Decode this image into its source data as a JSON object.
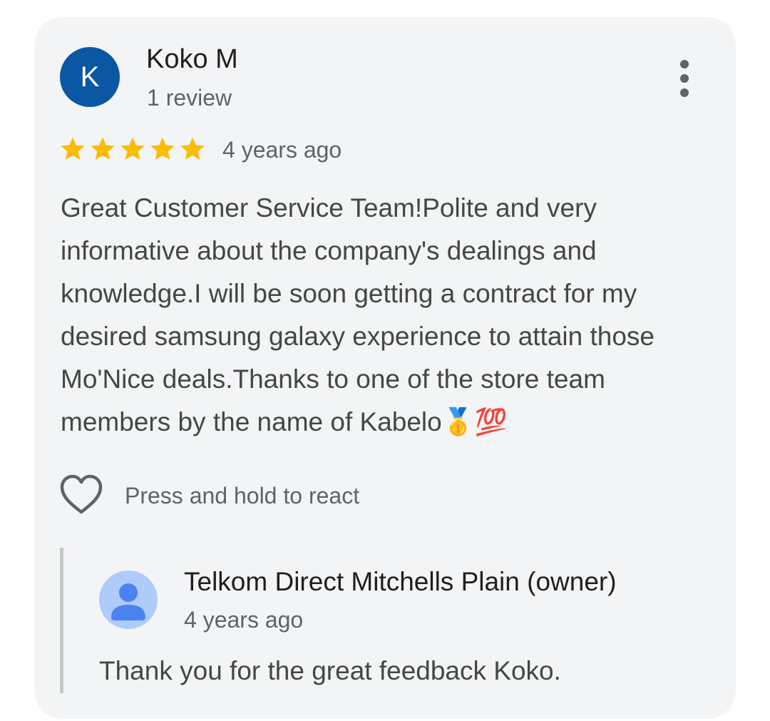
{
  "review": {
    "avatar_initial": "K",
    "avatar_color": "#0b57a4",
    "author": "Koko M",
    "author_meta": "1 review",
    "rating": 5,
    "rating_max": 5,
    "star_color": "#fbbc04",
    "time": "4 years ago",
    "text": "Great Customer Service Team!Polite and very informative about the company's dealings and knowledge.I will be soon getting a contract for my desired samsung galaxy experience to attain those Mo'Nice deals.Thanks to one of the store team members by the name of Kabelo🥇💯",
    "more_icon": "more-vert-icon",
    "react_icon": "heart-outline-icon",
    "react_hint": "Press and hold to react"
  },
  "owner_reply": {
    "avatar_icon": "person-icon",
    "author": "Telkom Direct Mitchells Plain (owner)",
    "time": "4 years ago",
    "text": "Thank you for the great feedback Koko."
  }
}
